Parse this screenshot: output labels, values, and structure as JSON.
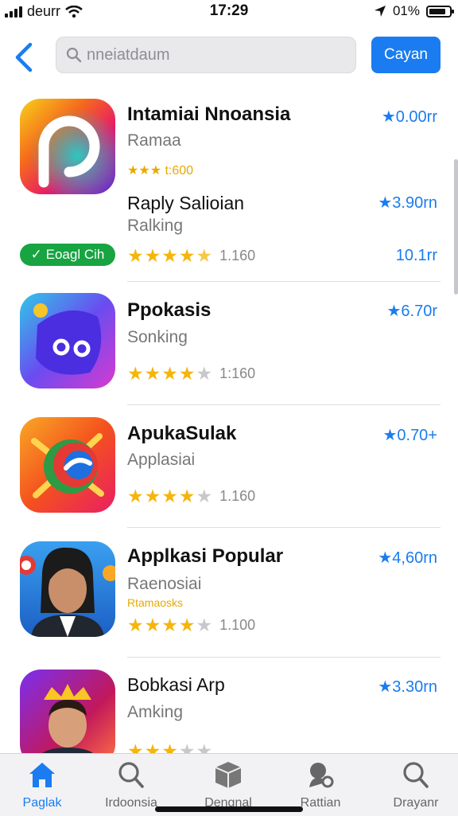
{
  "status_bar": {
    "carrier": "deurr",
    "time": "17:29",
    "battery": "01%"
  },
  "header": {
    "search_placeholder": "nneiatdaum",
    "cancel_label": "Cayan"
  },
  "apps": [
    {
      "name": "Intamiai Nnoansia",
      "subtitle": "Ramaa",
      "tag": "★★★ t:600",
      "price": "★0.00rr"
    },
    {
      "name": "Raply Salioian",
      "subtitle": "Ralking",
      "rating": 4.5,
      "count": "1.160",
      "price": "★3.90rn",
      "price2": "10.1rr",
      "badge": "✓ Eoagl Cih"
    },
    {
      "name": "Ppokasis",
      "subtitle": "Sonking",
      "rating": 4,
      "count": "1:160",
      "price": "★6.70r"
    },
    {
      "name": "ApukaSulak",
      "subtitle": "Applasiai",
      "rating": 4,
      "count": "1.160",
      "price": "★0.70+"
    },
    {
      "name": "Applkasi Popular",
      "subtitle": "Raenosiai",
      "tag": "Rtamaosks",
      "rating": 4,
      "count": "1.100",
      "price": "★4,60rn"
    },
    {
      "name": "Bobkasi Arp",
      "subtitle": "Amking",
      "rating": 3,
      "price": "★3.30rn"
    }
  ],
  "tabs": [
    {
      "label": "Paglak",
      "icon": "home-icon"
    },
    {
      "label": "Irdoonsia",
      "icon": "search-icon"
    },
    {
      "label": "Dengnal",
      "icon": "box-icon"
    },
    {
      "label": "Rattian",
      "icon": "person-search-icon"
    },
    {
      "label": "Drayanr",
      "icon": "search-icon"
    }
  ],
  "colors": {
    "accent": "#1a7cf0",
    "star": "#f5b50a",
    "badge": "#17a441"
  }
}
